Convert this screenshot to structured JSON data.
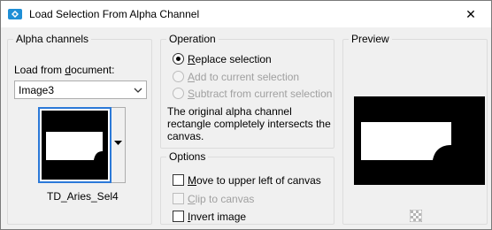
{
  "window": {
    "title": "Load Selection From Alpha Channel",
    "close_glyph": "✕"
  },
  "alpha_channels": {
    "group_label": "Alpha channels",
    "load_from_document_label": "Load from document:",
    "load_from_document_hotkey": "d",
    "document_select": {
      "value": "Image3"
    },
    "channel_name": "TD_Aries_Sel4"
  },
  "operation": {
    "group_label": "Operation",
    "options": [
      {
        "label": "Replace selection",
        "hotkey": "R",
        "selected": true,
        "enabled": true
      },
      {
        "label": "Add to current selection",
        "hotkey": "A",
        "selected": false,
        "enabled": false
      },
      {
        "label": "Subtract from current selection",
        "hotkey": "S",
        "selected": false,
        "enabled": false
      }
    ],
    "info_text_lines": [
      "The original alpha channel",
      "rectangle completely intersects the",
      "canvas."
    ]
  },
  "options": {
    "group_label": "Options",
    "checkboxes": [
      {
        "label": "Move to upper left of canvas",
        "hotkey": "M",
        "checked": false,
        "enabled": true
      },
      {
        "label": "Clip to canvas",
        "hotkey": "C",
        "checked": false,
        "enabled": false
      },
      {
        "label": "Invert image",
        "hotkey": "I",
        "checked": false,
        "enabled": true
      }
    ]
  },
  "preview": {
    "group_label": "Preview"
  },
  "icons": {
    "app": "app-diamond-icon",
    "close": "close-icon",
    "dropdown": "chevron-down-icon",
    "checker": "transparency-checker-icon"
  }
}
